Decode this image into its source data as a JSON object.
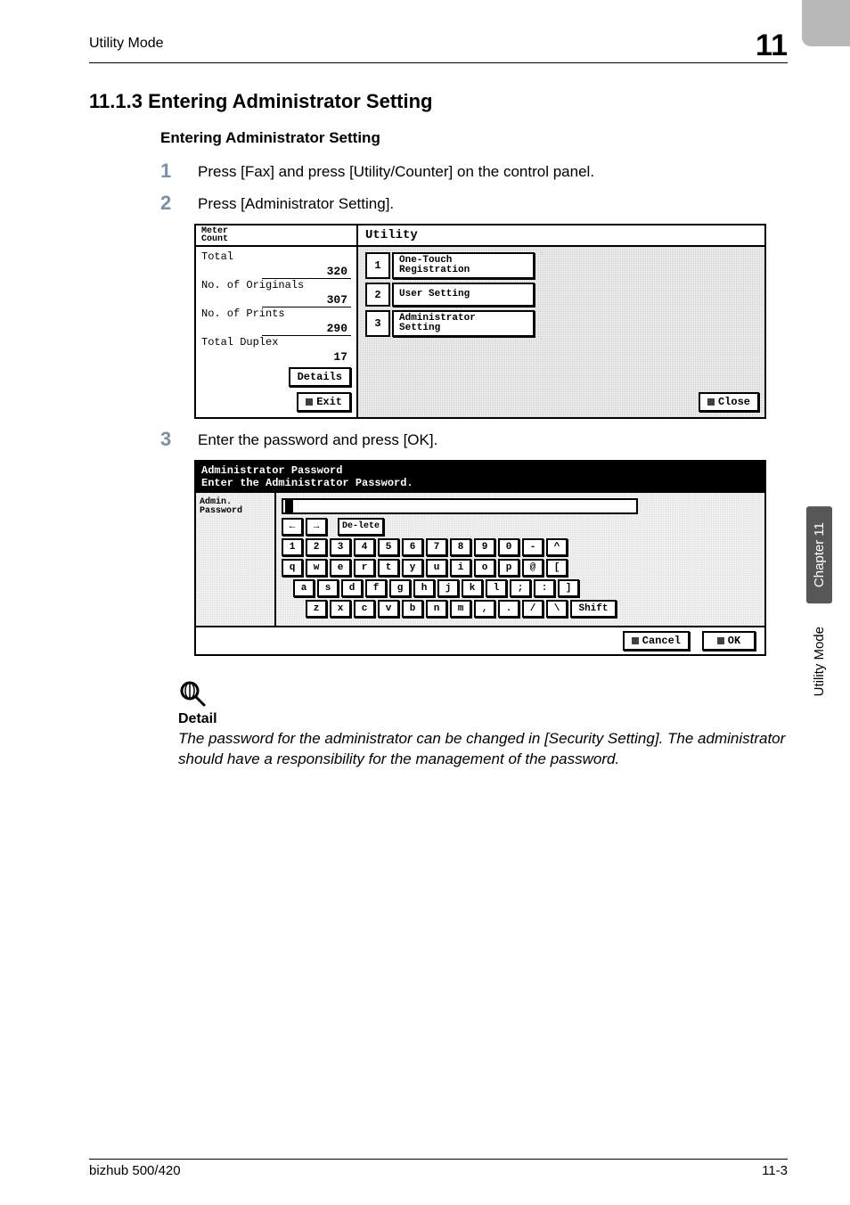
{
  "running_head": {
    "title": "Utility Mode",
    "chapter_num": "11"
  },
  "section_heading": "11.1.3  Entering Administrator Setting",
  "subheading": "Entering Administrator Setting",
  "steps": {
    "s1_num": "1",
    "s1_text": "Press [Fax] and press [Utility/Counter] on the control panel.",
    "s2_num": "2",
    "s2_text": "Press [Administrator Setting].",
    "s3_num": "3",
    "s3_text": "Enter the password and press [OK]."
  },
  "shot1": {
    "meter_title_l1": "Meter",
    "meter_title_l2": "Count",
    "total_label": "Total",
    "total_val": "320",
    "orig_label": "No. of Originals",
    "orig_val": "307",
    "prints_label": "No. of Prints",
    "prints_val": "290",
    "duplex_label": "Total Duplex",
    "duplex_val": "17",
    "details_btn": "Details",
    "exit_btn": "Exit",
    "utility_title": "Utility",
    "item1_n": "1",
    "item1_l1": "One-Touch",
    "item1_l2": "Registration",
    "item2_n": "2",
    "item2_label": "User Setting",
    "item3_n": "3",
    "item3_l1": "Administrator",
    "item3_l2": "Setting",
    "close_btn": "Close"
  },
  "shot2": {
    "header_l1": "Administrator Password",
    "header_l2": "Enter the Administrator Password.",
    "left_l1": "Admin.",
    "left_l2": "Password",
    "arrow_left": "←",
    "arrow_right": "→",
    "delete_l1": "De-",
    "delete_l2": "lete",
    "row1": [
      "1",
      "2",
      "3",
      "4",
      "5",
      "6",
      "7",
      "8",
      "9",
      "0",
      "-",
      "^"
    ],
    "row2": [
      "q",
      "w",
      "e",
      "r",
      "t",
      "y",
      "u",
      "i",
      "o",
      "p",
      "@",
      "["
    ],
    "row3": [
      "a",
      "s",
      "d",
      "f",
      "g",
      "h",
      "j",
      "k",
      "l",
      ";",
      ":",
      "]"
    ],
    "row4": [
      "z",
      "x",
      "c",
      "v",
      "b",
      "n",
      "m",
      ",",
      ".",
      "/",
      "\\"
    ],
    "shift": "Shift",
    "cancel_btn": "Cancel",
    "ok_btn": "OK"
  },
  "detail": {
    "head": "Detail",
    "body": "The password for the administrator can be changed in [Security Setting]. The administrator should have a responsibility for the management of the password."
  },
  "side_tab": {
    "dark": "Chapter 11",
    "light": "Utility Mode"
  },
  "footer": {
    "left": "bizhub 500/420",
    "right": "11-3"
  }
}
